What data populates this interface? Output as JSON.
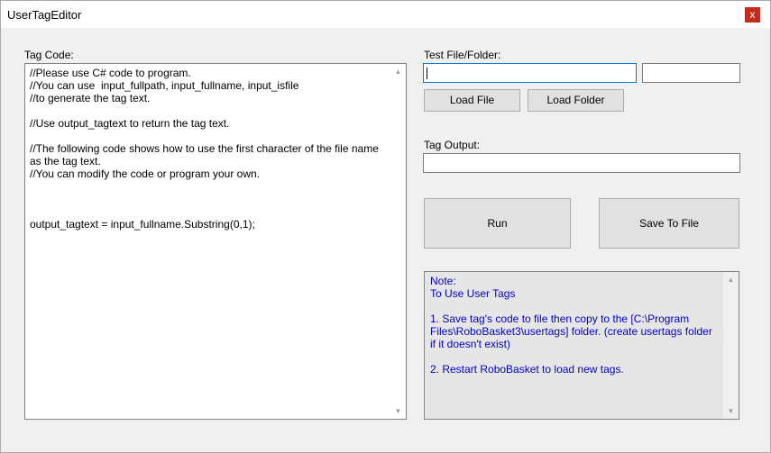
{
  "window": {
    "title": "UserTagEditor",
    "close_glyph": "x"
  },
  "tag_code": {
    "label": "Tag Code:",
    "code": "//Please use C# code to program.\n//You can use  input_fullpath, input_fullname, input_isfile\n//to generate the tag text.\n\n//Use output_tagtext to return the tag text.\n\n//The following code shows how to use the first character of the file name as the tag text.\n//You can modify the code or program your own.\n\n\n\noutput_tagtext = input_fullname.Substring(0,1);"
  },
  "test": {
    "label": "Test File/Folder:",
    "path_value": "",
    "result_value": "",
    "load_file_label": "Load File",
    "load_folder_label": "Load Folder"
  },
  "tag_output": {
    "label": "Tag Output:",
    "value": ""
  },
  "actions": {
    "run_label": "Run",
    "save_label": "Save To File"
  },
  "note": {
    "text": "Note:\nTo Use User Tags\n\n1. Save tag's code to file then copy to the [C:\\Program Files\\RoboBasket3\\usertags] folder. (create usertags folder if it doesn't exist)\n\n2. Restart RoboBasket to load new tags."
  },
  "icons": {
    "scroll_up": "▲",
    "scroll_down": "▼"
  }
}
